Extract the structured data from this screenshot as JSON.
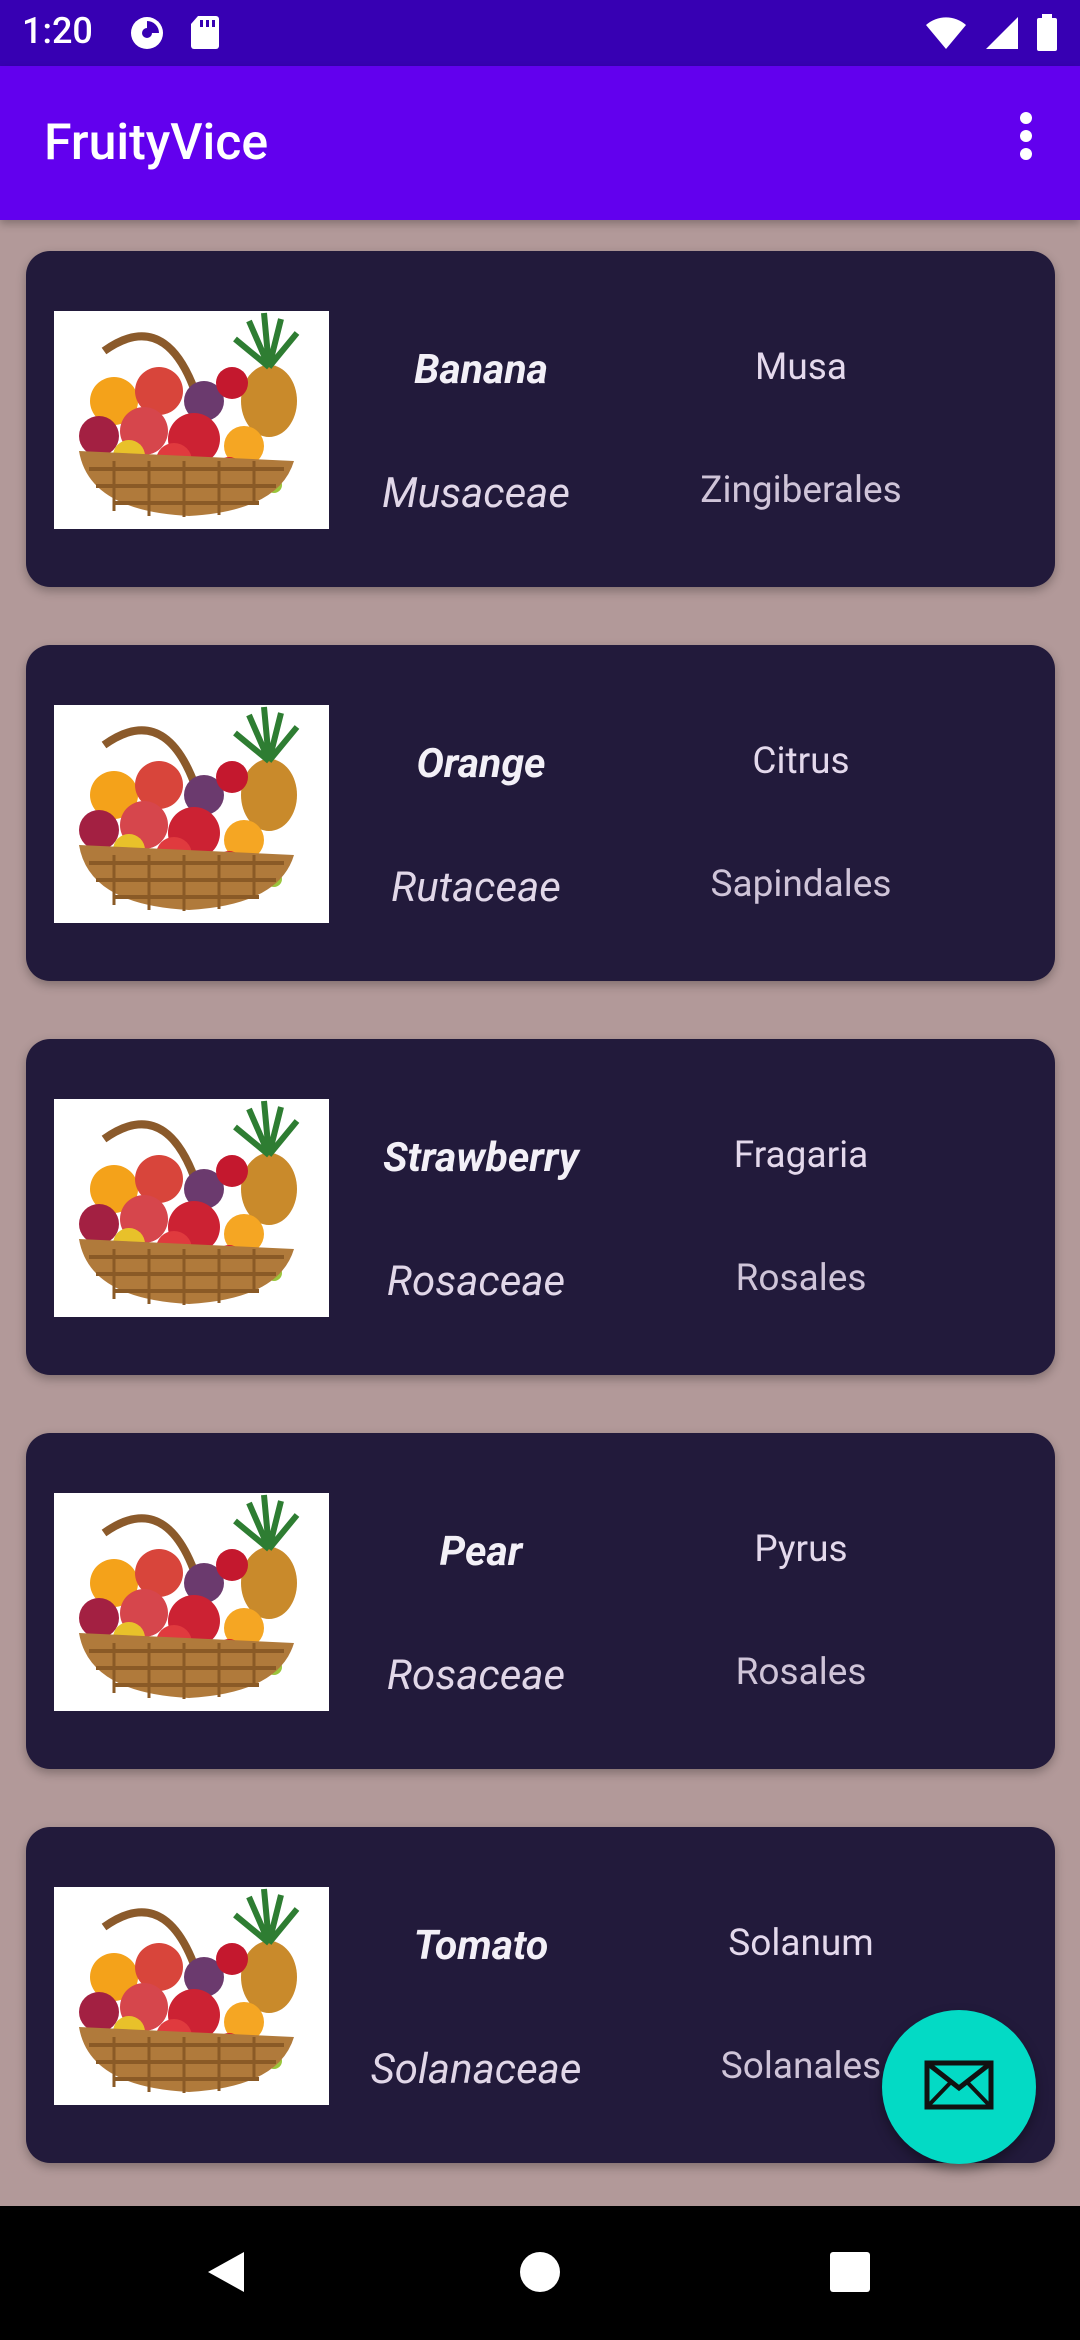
{
  "status": {
    "time": "1:20"
  },
  "app": {
    "title": "FruityVice"
  },
  "fruits": [
    {
      "name": "Banana",
      "family": "Musaceae",
      "genus": "Musa",
      "order": "Zingiberales"
    },
    {
      "name": "Orange",
      "family": "Rutaceae",
      "genus": "Citrus",
      "order": "Sapindales"
    },
    {
      "name": "Strawberry",
      "family": "Rosaceae",
      "genus": "Fragaria",
      "order": "Rosales"
    },
    {
      "name": "Pear",
      "family": "Rosaceae",
      "genus": "Pyrus",
      "order": "Rosales"
    },
    {
      "name": "Tomato",
      "family": "Solanaceae",
      "genus": "Solanum",
      "order": "Solanales"
    }
  ],
  "colors": {
    "statusBar": "#3700b3",
    "appBar": "#6200ee",
    "background": "#b29999",
    "card": "#221a3b",
    "fab": "#03dac5"
  },
  "icons": {
    "overflow": "more-vert-icon",
    "fab": "email-icon",
    "navBack": "back-triangle-icon",
    "navHome": "home-circle-icon",
    "navRecents": "recents-square-icon"
  }
}
